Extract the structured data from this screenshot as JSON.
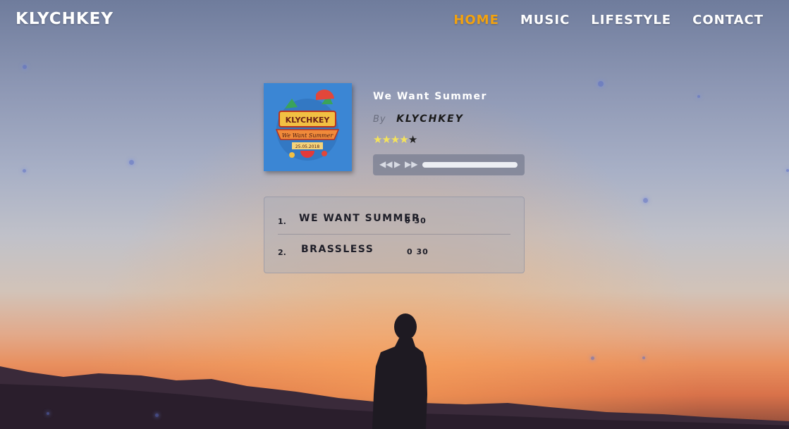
{
  "header": {
    "brand": "KLYCHKEY",
    "nav": [
      {
        "label": "HOME",
        "active": true
      },
      {
        "label": "MUSIC",
        "active": false
      },
      {
        "label": "LIFESTYLE",
        "active": false
      },
      {
        "label": "CONTACT",
        "active": false
      }
    ]
  },
  "album": {
    "cover": {
      "title": "KLYCHKEY",
      "subtitle": "We Want Summer",
      "date": "25.05.2018"
    },
    "track_title": "We Want Summer",
    "by_label": "By",
    "artist": "KLYCHKEY",
    "rating": {
      "value": 4,
      "max": 5
    }
  },
  "player": {
    "icons": [
      "rewind-icon",
      "play-icon",
      "fast-forward-icon"
    ]
  },
  "playlist": [
    {
      "number": "1.",
      "title": "WE WANT SUMMER",
      "duration": "0 30"
    },
    {
      "number": "2.",
      "title": "BRASSLESS",
      "duration": "0 30"
    }
  ],
  "colors": {
    "accent": "#f2a20f",
    "text": "#ffffff"
  }
}
